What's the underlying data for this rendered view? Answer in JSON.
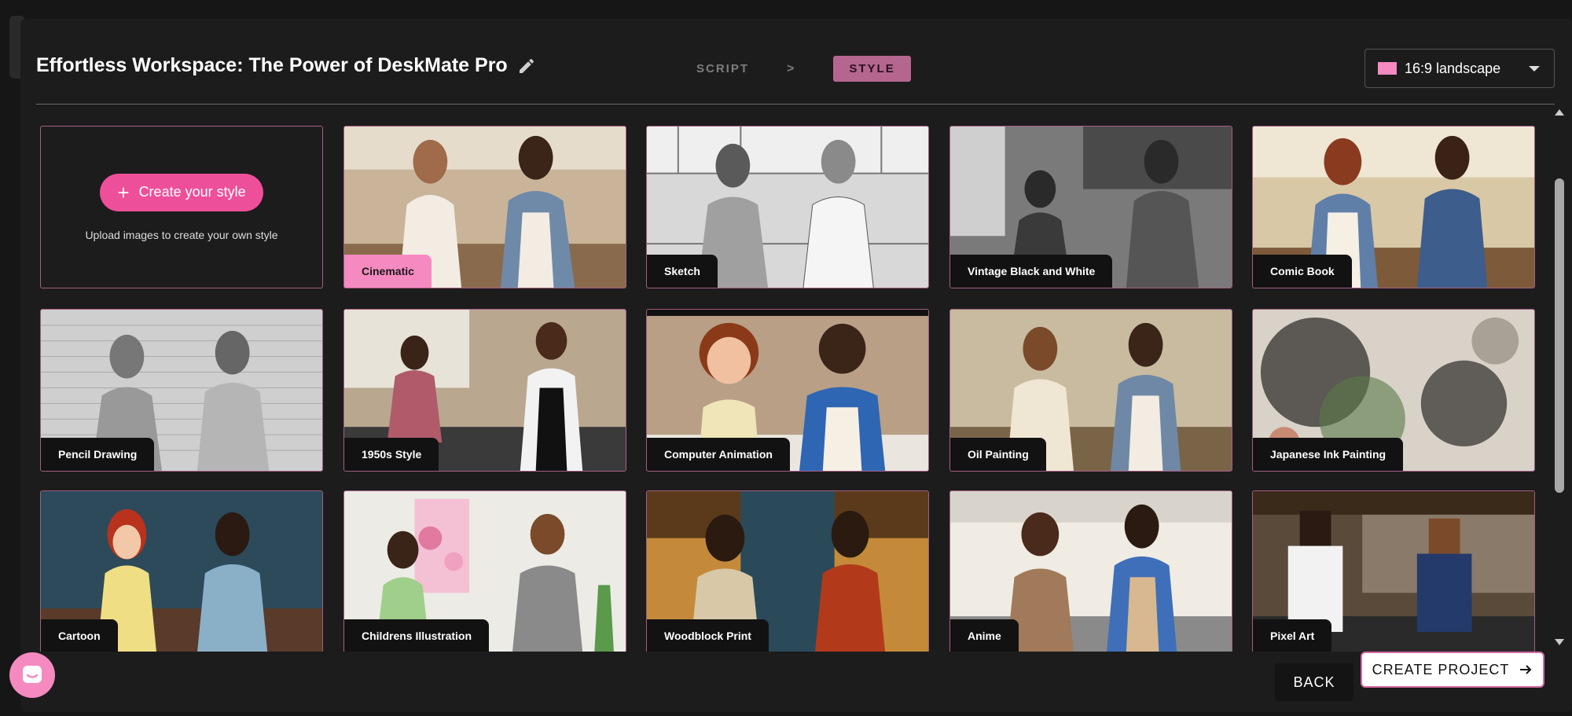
{
  "header": {
    "project_title": "Effortless Workspace: The Power of DeskMate Pro",
    "steps": [
      "SCRIPT",
      ">",
      "STYLE"
    ],
    "aspect_ratio": "16:9 landscape"
  },
  "create_style": {
    "button_label": "Create your style",
    "subtitle": "Upload images to create your own style"
  },
  "styles": [
    {
      "label": "Cinematic",
      "selected": true
    },
    {
      "label": "Sketch"
    },
    {
      "label": "Vintage Black and White"
    },
    {
      "label": "Comic Book"
    },
    {
      "label": "Pencil Drawing"
    },
    {
      "label": "1950s Style"
    },
    {
      "label": "Computer Animation"
    },
    {
      "label": "Oil Painting"
    },
    {
      "label": "Japanese Ink Painting"
    },
    {
      "label": "Cartoon"
    },
    {
      "label": "Childrens Illustration"
    },
    {
      "label": "Woodblock Print"
    },
    {
      "label": "Anime"
    },
    {
      "label": "Pixel Art"
    }
  ],
  "footer": {
    "back_label": "BACK",
    "create_project_label": "CREATE PROJECT"
  },
  "colors": {
    "accent": "#ee4f9a",
    "selected_label": "#f58ac0",
    "step_active": "#b5668f",
    "tile_border": "#a35f84"
  }
}
